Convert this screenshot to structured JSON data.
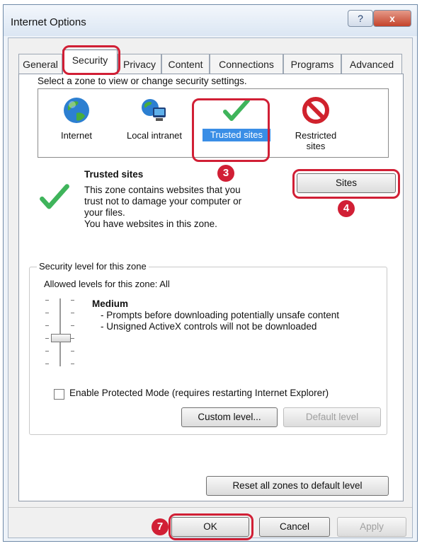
{
  "window": {
    "title": "Internet Options",
    "help_label": "?",
    "close_label": "x"
  },
  "tabs": [
    {
      "label": "General"
    },
    {
      "label": "Security"
    },
    {
      "label": "Privacy"
    },
    {
      "label": "Content"
    },
    {
      "label": "Connections"
    },
    {
      "label": "Programs"
    },
    {
      "label": "Advanced"
    }
  ],
  "security": {
    "prompt": "Select a zone to view or change security settings.",
    "zones": [
      {
        "label": "Internet",
        "icon": "globe-icon"
      },
      {
        "label": "Local intranet",
        "icon": "network-icon"
      },
      {
        "label": "Trusted sites",
        "icon": "checkmark-icon",
        "selected": true
      },
      {
        "label": "Restricted sites",
        "icon": "blocked-icon"
      }
    ],
    "zone_info": {
      "title": "Trusted sites",
      "desc1": "This zone contains websites that you",
      "desc2": "trust not to damage your computer or",
      "desc3": "your files.",
      "desc4": "You have websites in this zone."
    },
    "sites_label": "Sites",
    "level_group_label": "Security level for this zone",
    "allowed_levels": "Allowed levels for this zone: All",
    "level_name": "Medium",
    "level_desc1": "- Prompts before downloading potentially unsafe content",
    "level_desc2": "- Unsigned ActiveX controls will not be downloaded",
    "protected_mode_label": "Enable Protected Mode (requires restarting Internet Explorer)",
    "custom_level_label": "Custom level...",
    "default_level_label": "Default level",
    "reset_label": "Reset all zones to default level"
  },
  "footer": {
    "ok_label": "OK",
    "cancel_label": "Cancel",
    "apply_label": "Apply"
  },
  "annotations": {
    "step3": "3",
    "step4": "4",
    "step7": "7"
  },
  "colors": {
    "highlight": "#d11f35",
    "selection": "#3a8ee6"
  }
}
